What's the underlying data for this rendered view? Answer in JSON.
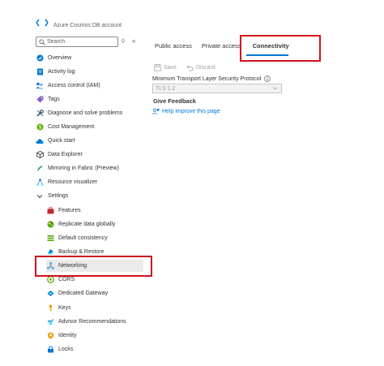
{
  "header": {
    "resource_type": "Azure Cosmos DB account"
  },
  "sidebar": {
    "search_placeholder": "Search",
    "items": [
      {
        "label": "Overview",
        "icon": "overview-icon"
      },
      {
        "label": "Activity log",
        "icon": "activity-log-icon"
      },
      {
        "label": "Access control (IAM)",
        "icon": "iam-icon"
      },
      {
        "label": "Tags",
        "icon": "tag-icon"
      },
      {
        "label": "Diagnose and solve problems",
        "icon": "wrench-icon"
      },
      {
        "label": "Cost Management",
        "icon": "cost-icon"
      },
      {
        "label": "Quick start",
        "icon": "cloud-icon"
      },
      {
        "label": "Data Explorer",
        "icon": "cube-icon"
      },
      {
        "label": "Mirroring in Fabric (Preview)",
        "icon": "fabric-icon"
      },
      {
        "label": "Resource visualizer",
        "icon": "graph-icon"
      },
      {
        "label": "Settings",
        "icon": "chevron-down-icon"
      }
    ],
    "settings_items": [
      {
        "label": "Features",
        "icon": "briefcase-icon"
      },
      {
        "label": "Replicate data globally",
        "icon": "globe-icon"
      },
      {
        "label": "Default consistency",
        "icon": "lines-icon"
      },
      {
        "label": "Backup & Restore",
        "icon": "backup-icon"
      },
      {
        "label": "Networking",
        "icon": "network-icon"
      },
      {
        "label": "CORS",
        "icon": "cors-icon"
      },
      {
        "label": "Dedicated Gateway",
        "icon": "gateway-icon"
      },
      {
        "label": "Keys",
        "icon": "key-icon"
      },
      {
        "label": "Advisor Recommendations",
        "icon": "advisor-icon"
      },
      {
        "label": "Identity",
        "icon": "identity-icon"
      },
      {
        "label": "Locks",
        "icon": "lock-icon"
      }
    ]
  },
  "tabs": [
    {
      "label": "Public access"
    },
    {
      "label": "Private access"
    },
    {
      "label": "Connectivity"
    }
  ],
  "toolbar": {
    "save_label": "Save",
    "discard_label": "Discard"
  },
  "tls": {
    "label": "Minimum Transport Layer Security Protocol",
    "value": "TLS 1.2"
  },
  "feedback": {
    "title": "Give Feedback",
    "link_label": "Help improve this page"
  },
  "colors": {
    "accent": "#0078d4",
    "highlight": "#d0101b",
    "selected_bg": "#eaeaea"
  }
}
